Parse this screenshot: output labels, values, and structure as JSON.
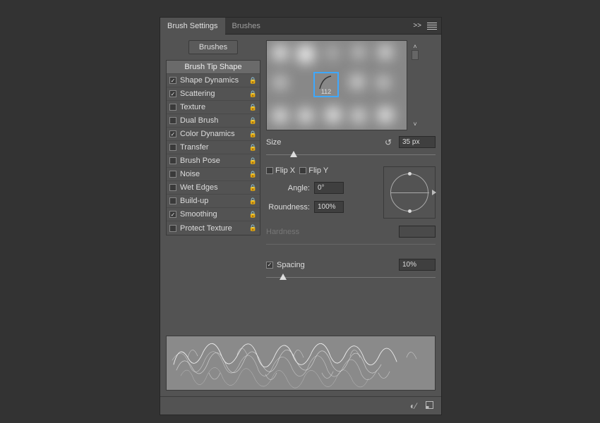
{
  "tabs": {
    "active": "Brush Settings",
    "other": "Brushes"
  },
  "brushesButton": "Brushes",
  "options": {
    "header": "Brush Tip Shape",
    "items": [
      {
        "label": "Shape Dynamics",
        "checked": true
      },
      {
        "label": "Scattering",
        "checked": true
      },
      {
        "label": "Texture",
        "checked": false
      },
      {
        "label": "Dual Brush",
        "checked": false
      },
      {
        "label": "Color Dynamics",
        "checked": true
      },
      {
        "label": "Transfer",
        "checked": false
      },
      {
        "label": "Brush Pose",
        "checked": false
      },
      {
        "label": "Noise",
        "checked": false
      },
      {
        "label": "Wet Edges",
        "checked": false
      },
      {
        "label": "Build-up",
        "checked": false
      },
      {
        "label": "Smoothing",
        "checked": true
      },
      {
        "label": "Protect Texture",
        "checked": false
      }
    ]
  },
  "selectedBrushSize": "112",
  "size": {
    "label": "Size",
    "value": "35 px",
    "sliderPct": 14
  },
  "flip": {
    "xLabel": "Flip X",
    "yLabel": "Flip Y",
    "x": false,
    "y": false
  },
  "angle": {
    "label": "Angle:",
    "value": "0°"
  },
  "roundness": {
    "label": "Roundness:",
    "value": "100%"
  },
  "hardness": {
    "label": "Hardness"
  },
  "spacing": {
    "label": "Spacing",
    "checked": true,
    "value": "10%",
    "sliderPct": 8
  }
}
